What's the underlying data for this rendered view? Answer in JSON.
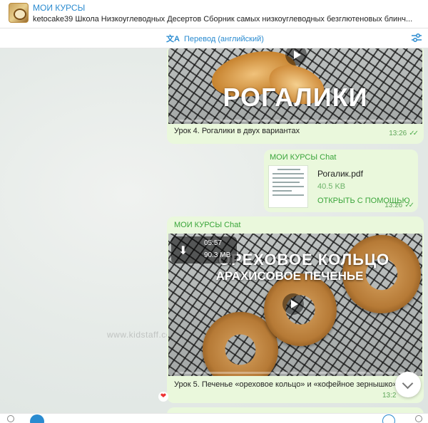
{
  "header": {
    "title": "МОИ КУРСЫ",
    "subtitle": "ketocake39 Школа Низкоуглеводных Десертов  Сборник самых низкоуглеводных безглютеновых блинч..."
  },
  "translate_bar": {
    "label": "Перевод (английский)",
    "icon": "translate-icon",
    "settings_icon": "sliders-icon"
  },
  "messages": [
    {
      "type": "video",
      "overlay": "РОГАЛИКИ",
      "caption": "Урок 4. Рогалики в двух вариантах",
      "time": "13:26"
    },
    {
      "type": "file",
      "sender": "МОИ КУРСЫ Chat",
      "file_name": "Рогалик.pdf",
      "file_size": "40.5 KB",
      "action": "ОТКРЫТЬ С ПОМОЩЬЮ",
      "time": "13:26"
    },
    {
      "type": "video",
      "sender": "МОИ КУРСЫ Chat",
      "overlay_line1": "ОРЕХОВОЕ КОЛЬЦО",
      "overlay_line2": "АРАХИСОВОЕ ПЕЧЕНЬЕ",
      "duration": "05:57",
      "size": "90.3 MB",
      "caption": "Урок 5. Печенье «ореховое кольцо» и «кофейное зернышко»",
      "time": "13:2",
      "reaction": "❤"
    }
  ],
  "watermark": "www.kidstaff.com.ua/user-1795518.html",
  "colors": {
    "accent": "#2a8bd0",
    "bubble": "#eaf8dc",
    "sender": "#3aa53a"
  }
}
